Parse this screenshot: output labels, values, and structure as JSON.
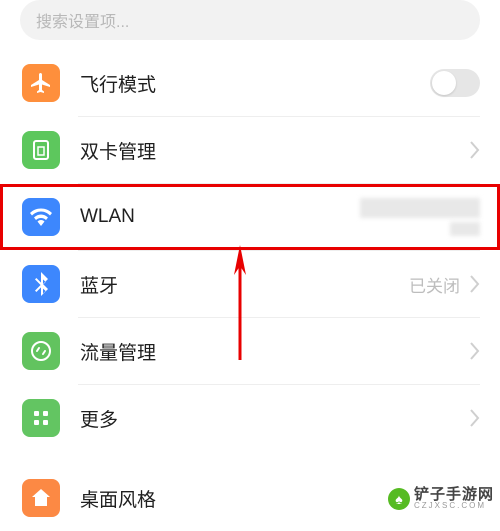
{
  "search": {
    "placeholder": "搜索设置项..."
  },
  "rows": {
    "airplane": {
      "label": "飞行模式",
      "toggle": "off"
    },
    "dualsim": {
      "label": "双卡管理"
    },
    "wlan": {
      "label": "WLAN"
    },
    "bluetooth": {
      "label": "蓝牙",
      "value": "已关闭"
    },
    "traffic": {
      "label": "流量管理"
    },
    "more": {
      "label": "更多"
    },
    "desktop": {
      "label": "桌面风格"
    }
  },
  "highlight": "wlan",
  "watermark": {
    "site_cn": "铲子手游网",
    "site_en": "CZJXSC.COM"
  }
}
